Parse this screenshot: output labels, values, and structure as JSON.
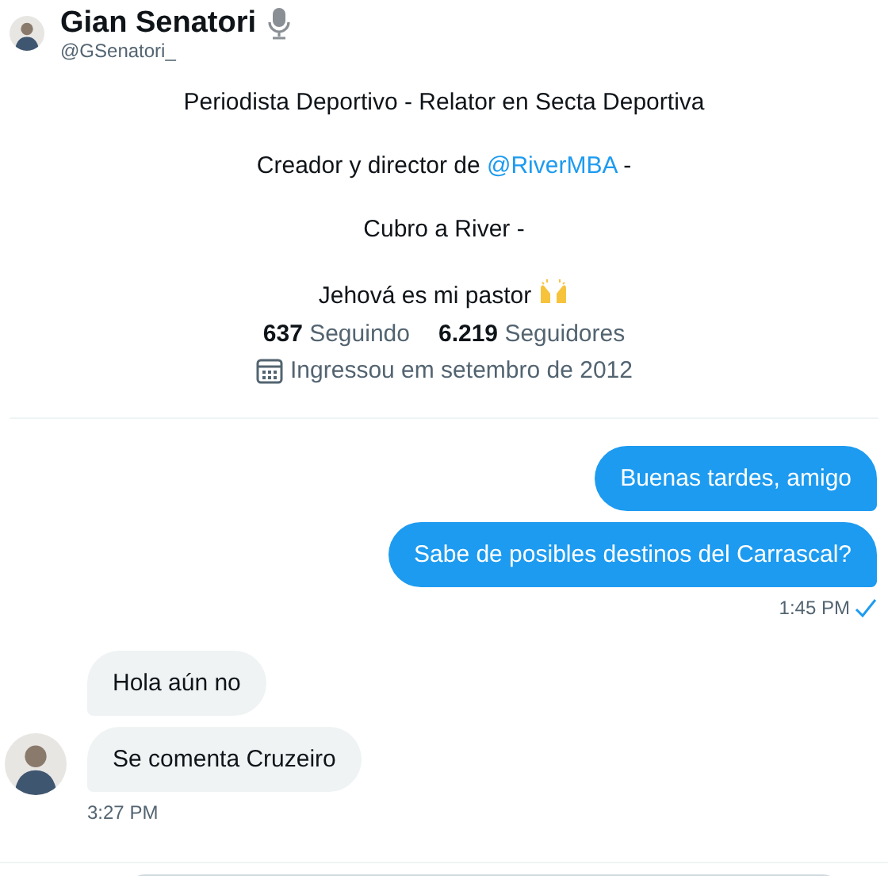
{
  "header": {
    "name": "Gian Senatori",
    "handle": "@GSenatori_"
  },
  "bio": [
    [
      {
        "kind": "text",
        "text": "Periodista Deportivo - Relator en Secta Deportiva"
      }
    ],
    [
      {
        "kind": "text",
        "text": "Creador y director de "
      },
      {
        "kind": "mention",
        "text": "@RiverMBA"
      },
      {
        "kind": "text",
        "text": " -"
      }
    ],
    [
      {
        "kind": "text",
        "text": "Cubro a River -"
      }
    ],
    [
      {
        "kind": "text",
        "text": "Jehová es mi pastor"
      },
      {
        "kind": "emoji"
      }
    ]
  ],
  "stats": [
    {
      "count": "637",
      "label": "Seguindo"
    },
    {
      "count": "6.219",
      "label": "Seguidores"
    }
  ],
  "joined": "Ingressou em setembro de 2012",
  "groups": [
    {
      "kind": "outgoing",
      "messages": [
        "Buenas tardes, amigo",
        "Sabe de posibles destinos del Carrascal?"
      ],
      "time": "1:45 PM",
      "read": true
    },
    {
      "kind": "incoming",
      "messages": [
        "Hola aún no",
        "Se comenta Cruzeiro"
      ],
      "time": "3:27 PM"
    }
  ]
}
